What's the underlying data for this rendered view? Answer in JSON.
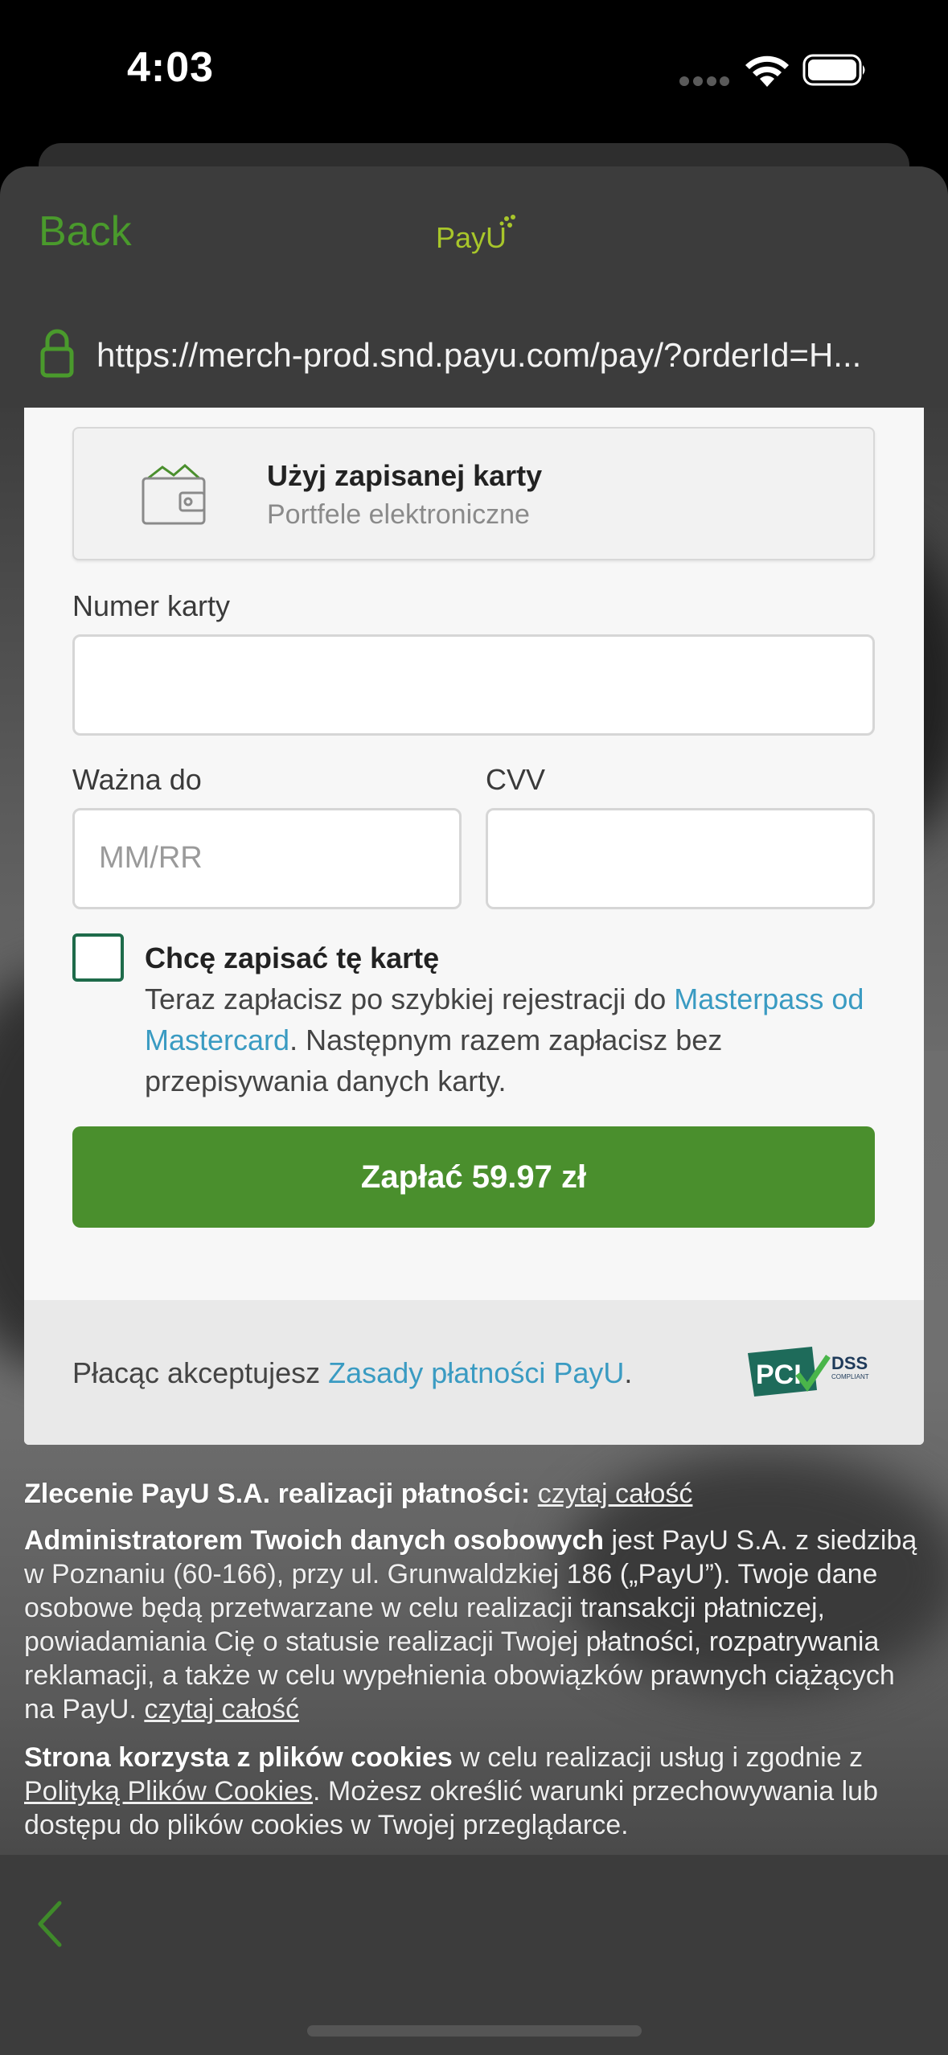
{
  "status_bar": {
    "time": "4:03"
  },
  "browser": {
    "back_label": "Back",
    "logo_text": "PayU",
    "url": "https://merch-prod.snd.payu.com/pay/?orderId=H..."
  },
  "saved_card": {
    "title": "Użyj zapisanej karty",
    "subtitle": "Portfele elektroniczne"
  },
  "form": {
    "card_number_label": "Numer karty",
    "card_number_value": "",
    "expiry_label": "Ważna do",
    "expiry_placeholder": "MM/RR",
    "cvv_label": "CVV",
    "cvv_value": ""
  },
  "save_card": {
    "title": "Chcę zapisać tę kartę",
    "desc_before": "Teraz zapłacisz po szybkiej rejestracji do ",
    "desc_link": "Masterpass od Mastercard",
    "desc_after": ". Następnym razem zapłacisz bez przepisywania danych karty."
  },
  "pay_button": {
    "label": "Zapłać 59.97 zł"
  },
  "footer": {
    "terms_before": "Płacąc akceptujesz ",
    "terms_link": "Zasady płatności PayU",
    "terms_after": ".",
    "pci_text": "PCI",
    "dss_text": "DSS",
    "compliant_text": "COMPLIANT"
  },
  "legal": {
    "order_bold": "Zlecenie PayU S.A. realizacji płatności:",
    "order_link": "czytaj całość",
    "admin_bold": "Administratorem Twoich danych osobowych",
    "admin_text": " jest PayU S.A. z siedzibą w Poznaniu (60-166), przy ul. Grunwaldzkiej 186 („PayU”). Twoje dane osobowe będą przetwarzane w celu realizacji transakcji płatniczej, powiadamiania Cię o statusie realizacji Twojej płatności, rozpatrywania reklamacji, a także w celu wypełnienia obowiązków prawnych ciążących na PayU. ",
    "admin_link": "czytaj całość",
    "cookies_bold": "Strona korzysta z plików cookies",
    "cookies_text1": " w celu realizacji usług i zgodnie z ",
    "cookies_link": "Polityką Plików Cookies",
    "cookies_text2": ". Możesz określić warunki przechowywania lub dostępu do plików cookies w Twojej przeglądarce."
  },
  "colors": {
    "accent_green": "#4a9a2c",
    "button_green": "#4a8f2d",
    "link_blue": "#3a9bc2",
    "checkbox_border": "#1e6b4a"
  },
  "icons": [
    "wifi-icon",
    "battery-icon",
    "lock-icon",
    "wallet-icon",
    "chevron-left-icon"
  ]
}
